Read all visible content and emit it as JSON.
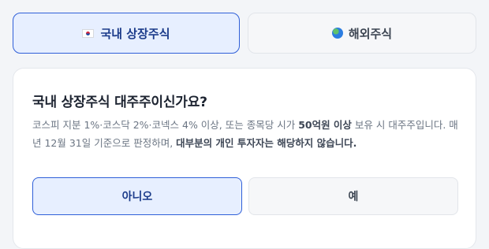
{
  "tabs": {
    "domestic": {
      "label": "국내 상장주식"
    },
    "overseas": {
      "label": "해외주식"
    }
  },
  "question": {
    "title": "국내 상장주식 대주주이신가요?",
    "desc_part1": "코스피 지분 1%·코스닥 2%·코넥스 4% 이상, 또는 종목당 시가 ",
    "desc_bold1": "50억원 이상",
    "desc_part2": " 보유 시 대주주입니다. 매년 12월 31일 기준으로 판정하며, ",
    "desc_bold2": "대부분의 개인 투자자는 해당하지 않습니다."
  },
  "answers": {
    "no": "아니오",
    "yes": "예"
  },
  "colors": {
    "accent": "#2f5fd8",
    "accent_bg": "#e7efff"
  },
  "icons": {
    "domestic": "korea-flag-icon",
    "overseas": "globe-icon"
  }
}
